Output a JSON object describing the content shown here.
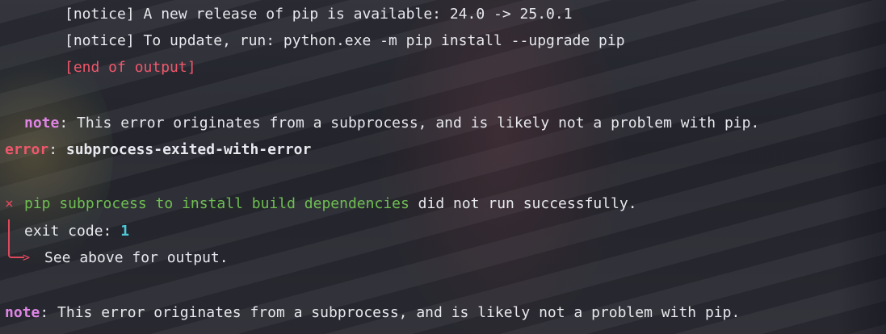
{
  "terminal": {
    "notice_release": "[notice] A new release of pip is available: 24.0 -> 25.0.1",
    "notice_update": "[notice] To update, run: python.exe -m pip install --upgrade pip",
    "end_of_output": "[end of output]",
    "inner_note_label": "note",
    "inner_note_text": ": This error originates from a subprocess, and is likely not a problem with pip.",
    "error_label": "error",
    "error_sep": ": ",
    "error_text": "subprocess-exited-with-error",
    "cross_glyph": "×",
    "failure_highlight": "pip subprocess to install build dependencies",
    "failure_rest": " did not run successfully.",
    "exit_code_label": "exit code: ",
    "exit_code_value": "1",
    "see_above": "See above for output.",
    "outer_note_label": "note",
    "outer_note_text": ": This error originates from a subprocess, and is likely not a problem with pip."
  },
  "colors": {
    "text": "#e7e9ee",
    "error_red": "#f0576b",
    "note_pink": "#e085e6",
    "success_green": "#6fbf52",
    "number_cyan": "#4dc8d8"
  }
}
